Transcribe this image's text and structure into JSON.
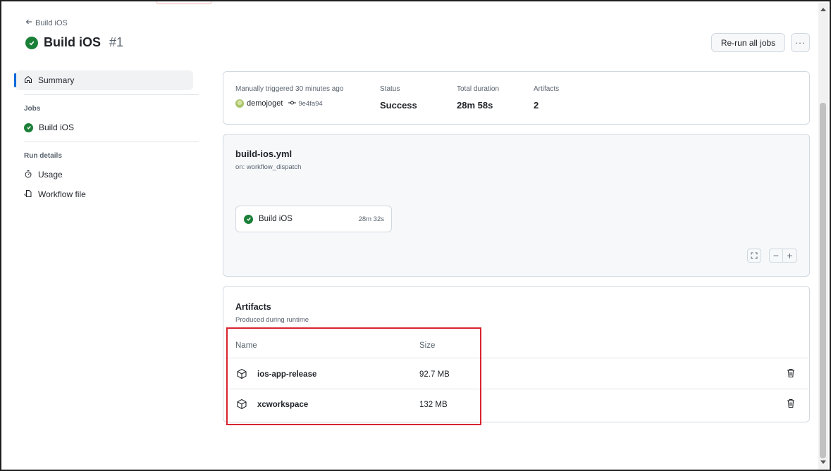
{
  "header": {
    "back_label": "Build iOS",
    "title": "Build iOS",
    "run_number": "#1",
    "rerun_label": "Re-run all jobs",
    "more_label": "···"
  },
  "sidebar": {
    "summary_label": "Summary",
    "jobs_heading": "Jobs",
    "job_label": "Build iOS",
    "run_details_heading": "Run details",
    "usage_label": "Usage",
    "workflow_file_label": "Workflow file"
  },
  "summary": {
    "trigger_text": "Manually triggered 30 minutes ago",
    "actor": "demojoget",
    "commit": "9e4fa94",
    "status_label": "Status",
    "status_value": "Success",
    "duration_label": "Total duration",
    "duration_value": "28m 58s",
    "artifacts_label": "Artifacts",
    "artifacts_value": "2"
  },
  "workflow": {
    "file_name": "build-ios.yml",
    "trigger": "on: workflow_dispatch",
    "job_name": "Build iOS",
    "job_duration": "28m 32s"
  },
  "artifacts": {
    "title": "Artifacts",
    "subtitle": "Produced during runtime",
    "col_name": "Name",
    "col_size": "Size",
    "items": [
      {
        "name": "ios-app-release",
        "size": "92.7 MB"
      },
      {
        "name": "xcworkspace",
        "size": "132 MB"
      }
    ]
  },
  "colors": {
    "success": "#1a7f37",
    "accent": "#0969da",
    "highlight": "#d9232e"
  }
}
